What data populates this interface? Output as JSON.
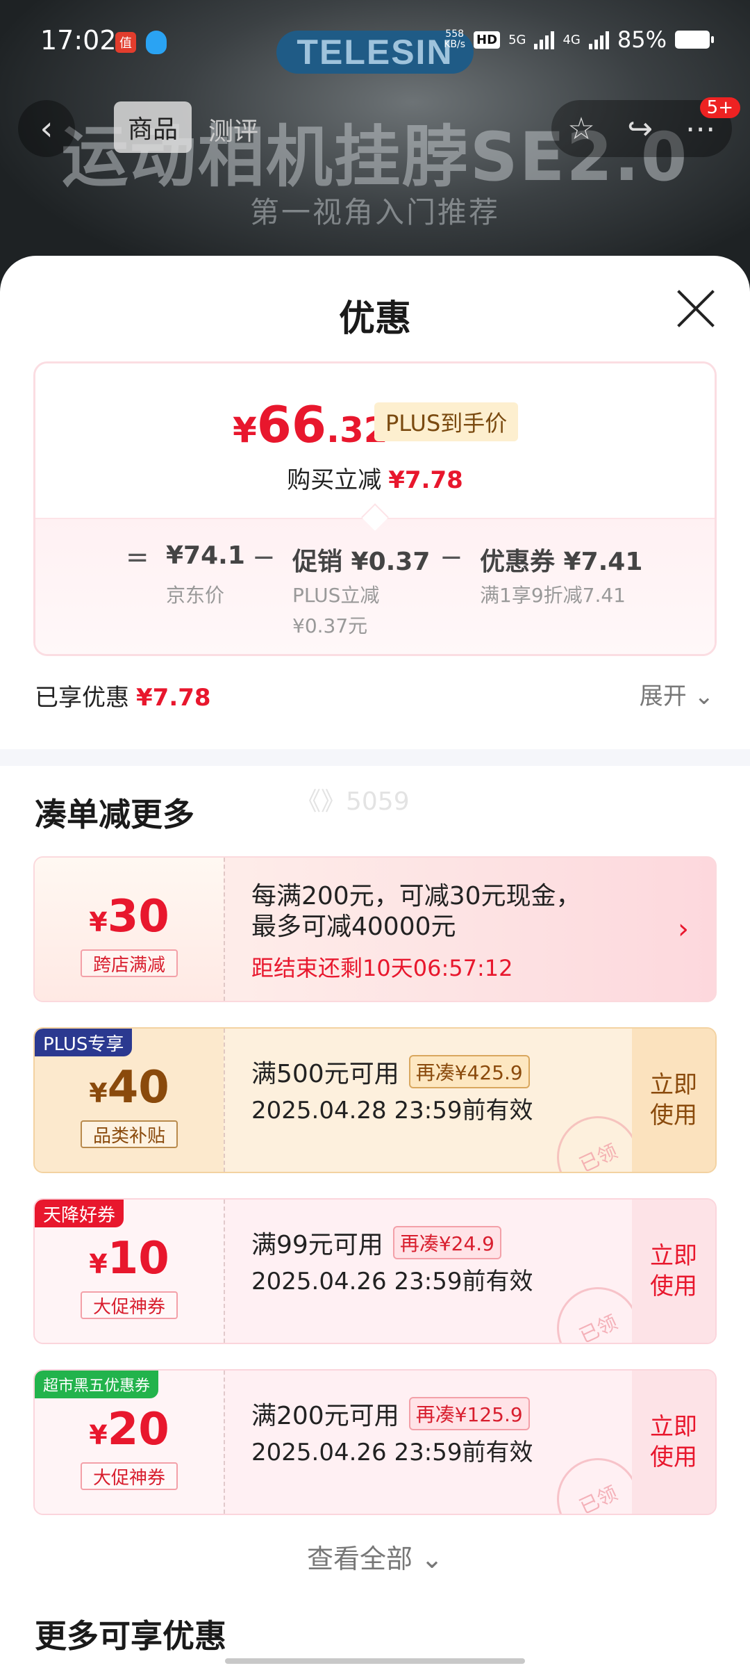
{
  "status_bar": {
    "time": "17:02",
    "net_speed": "558\nKB/s",
    "hd": "HD",
    "sig1": "5G",
    "sig2": "4G",
    "battery": "85%"
  },
  "banner": {
    "brand": "TELESIN",
    "title": "运动相机挂脖SE2.0",
    "subtitle": "第一视角入门推荐"
  },
  "nav": {
    "tab_goods": "商品",
    "tab_review": "测评",
    "badge": "5+"
  },
  "sheet": {
    "title": "优惠",
    "price": {
      "currency": "¥",
      "integer": "66",
      "decimal": ".32",
      "plus_tag": "PLUS到手价",
      "instant_label": "购买立减",
      "instant_value": "¥7.78"
    },
    "breakdown": {
      "eq": "=",
      "minus": "−",
      "jd_price": "¥74.1",
      "jd_label": "京东价",
      "promo_value": "促销 ¥0.37",
      "promo_sub1": "PLUS立减",
      "promo_sub2": "¥0.37元",
      "coupon_value": "优惠券 ¥7.41",
      "coupon_sub": "满1享9折减7.41"
    },
    "enjoyed_label": "已享优惠",
    "enjoyed_value": "¥7.78",
    "expand": "展开 ⌄"
  },
  "more_section": {
    "title": "凑单减更多",
    "watermark": "《》5059",
    "coupons": [
      {
        "currency": "¥",
        "amount": "30",
        "type": "跨店满减",
        "desc_line1": "每满200元，可减30元现金，",
        "desc_line2": "最多可减40000元",
        "timer": "距结束还剩10天06:57:12",
        "arrow": "›"
      },
      {
        "corner": "PLUS专享",
        "currency": "¥",
        "amount": "40",
        "type": "品类补贴",
        "condition": "满500元可用",
        "topup": "再凑¥425.9",
        "expiry": "2025.04.28 23:59前有效",
        "use": "立即\n使用",
        "stamp": "已领"
      },
      {
        "corner": "天降好券",
        "currency": "¥",
        "amount": "10",
        "type": "大促神券",
        "condition": "满99元可用",
        "topup": "再凑¥24.9",
        "expiry": "2025.04.26 23:59前有效",
        "use": "立即\n使用",
        "stamp": "已领"
      },
      {
        "corner": "超市黑五优惠券",
        "currency": "¥",
        "amount": "20",
        "type": "大促神券",
        "condition": "满200元可用",
        "topup": "再凑¥125.9",
        "expiry": "2025.04.26 23:59前有效",
        "use": "立即\n使用",
        "stamp": "已领"
      }
    ],
    "view_all": "查看全部 ⌄"
  },
  "more_offers_title": "更多可享优惠",
  "colors": {
    "accent_red": "#e8172d",
    "plus_navy": "#2b3990",
    "green_tag": "#22b34c"
  }
}
